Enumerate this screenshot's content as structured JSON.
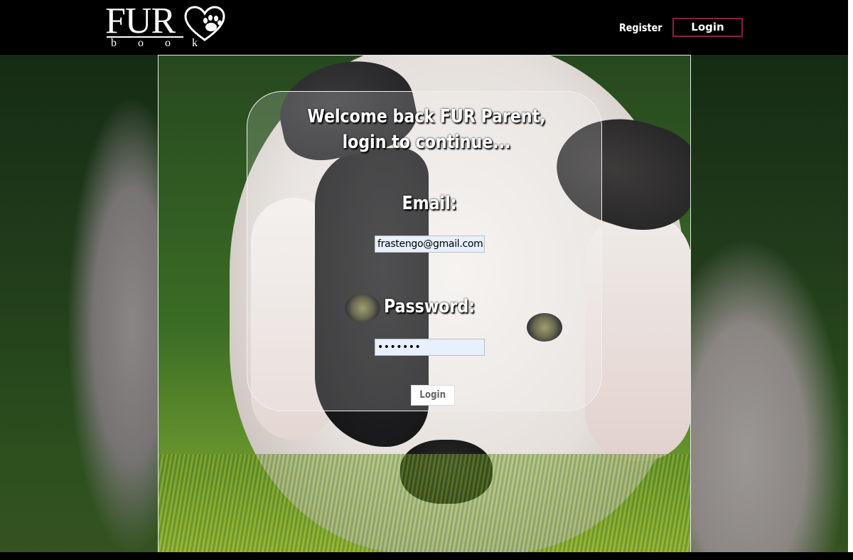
{
  "navbar": {
    "logo_text": "FUR",
    "logo_subtext": "book",
    "register_label": "Register",
    "login_label": "Login",
    "login_border_color": "#8a1f4a"
  },
  "login_card": {
    "welcome_line1": "Welcome back FUR Parent,",
    "welcome_line2": "login to continue...",
    "email_label": "Email:",
    "email_value": "frastengo@gmail.com",
    "password_label": "Password:",
    "password_value": "•••••••",
    "submit_label": "Login"
  },
  "icons": {
    "logo_mark": "heart-paw-icon"
  }
}
